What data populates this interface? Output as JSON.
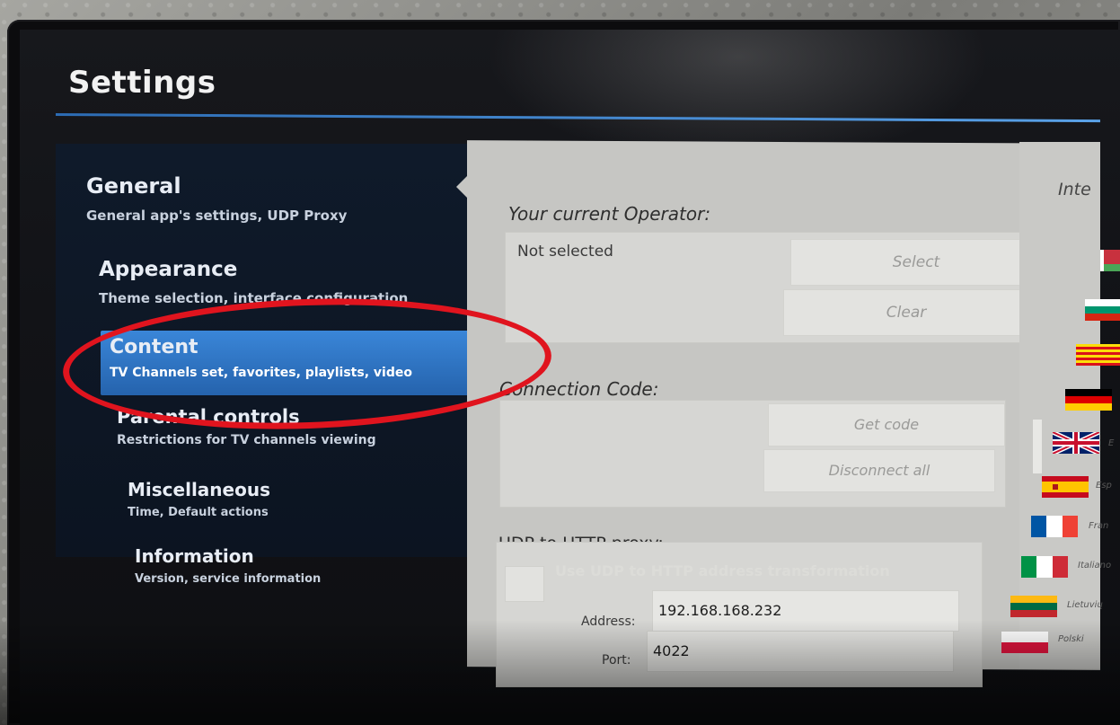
{
  "app": {
    "title": "Settings"
  },
  "sidebar": {
    "items": [
      {
        "id": "general",
        "label": "General",
        "desc": "General app's settings, UDP Proxy"
      },
      {
        "id": "appearance",
        "label": "Appearance",
        "desc": "Theme selection, interface configuration"
      },
      {
        "id": "content",
        "label": "Content",
        "desc": "TV Channels set, favorites, playlists, video",
        "active": true
      },
      {
        "id": "parental",
        "label": "Parental controls",
        "desc": "Restrictions for TV channels viewing"
      },
      {
        "id": "misc",
        "label": "Miscellaneous",
        "desc": "Time, Default actions"
      },
      {
        "id": "info",
        "label": "Information",
        "desc": "Version, service information"
      }
    ]
  },
  "operator": {
    "title": "Your current Operator:",
    "value": "Not selected",
    "select_label": "Select",
    "clear_label": "Clear"
  },
  "connection": {
    "title": "Connection Code:",
    "get_code_label": "Get code",
    "disconnect_label": "Disconnect all"
  },
  "udp_proxy": {
    "title": "UDP to HTTP proxy:",
    "checkbox_label": "Use UDP to HTTP address transformation",
    "checked": false,
    "address_label": "Address:",
    "address_value": "192.168.168.232",
    "port_label": "Port:",
    "port_value": "4022"
  },
  "languages": {
    "header": "Inte",
    "items": [
      {
        "flag": "belarus-flag"
      },
      {
        "flag": "bulgaria-flag"
      },
      {
        "flag": "catalonia-flag"
      },
      {
        "flag": "germany-flag"
      },
      {
        "flag": "uk-flag",
        "name": "E"
      },
      {
        "flag": "spain-flag",
        "name": "Esp"
      },
      {
        "flag": "france-flag",
        "name": "Fran"
      },
      {
        "flag": "italy-flag",
        "name": "Italiano"
      },
      {
        "flag": "lithuania-flag",
        "name": "Lietuvių"
      },
      {
        "flag": "poland-flag",
        "name": "Polski"
      }
    ]
  },
  "annotation": {
    "color": "#e0141e"
  }
}
